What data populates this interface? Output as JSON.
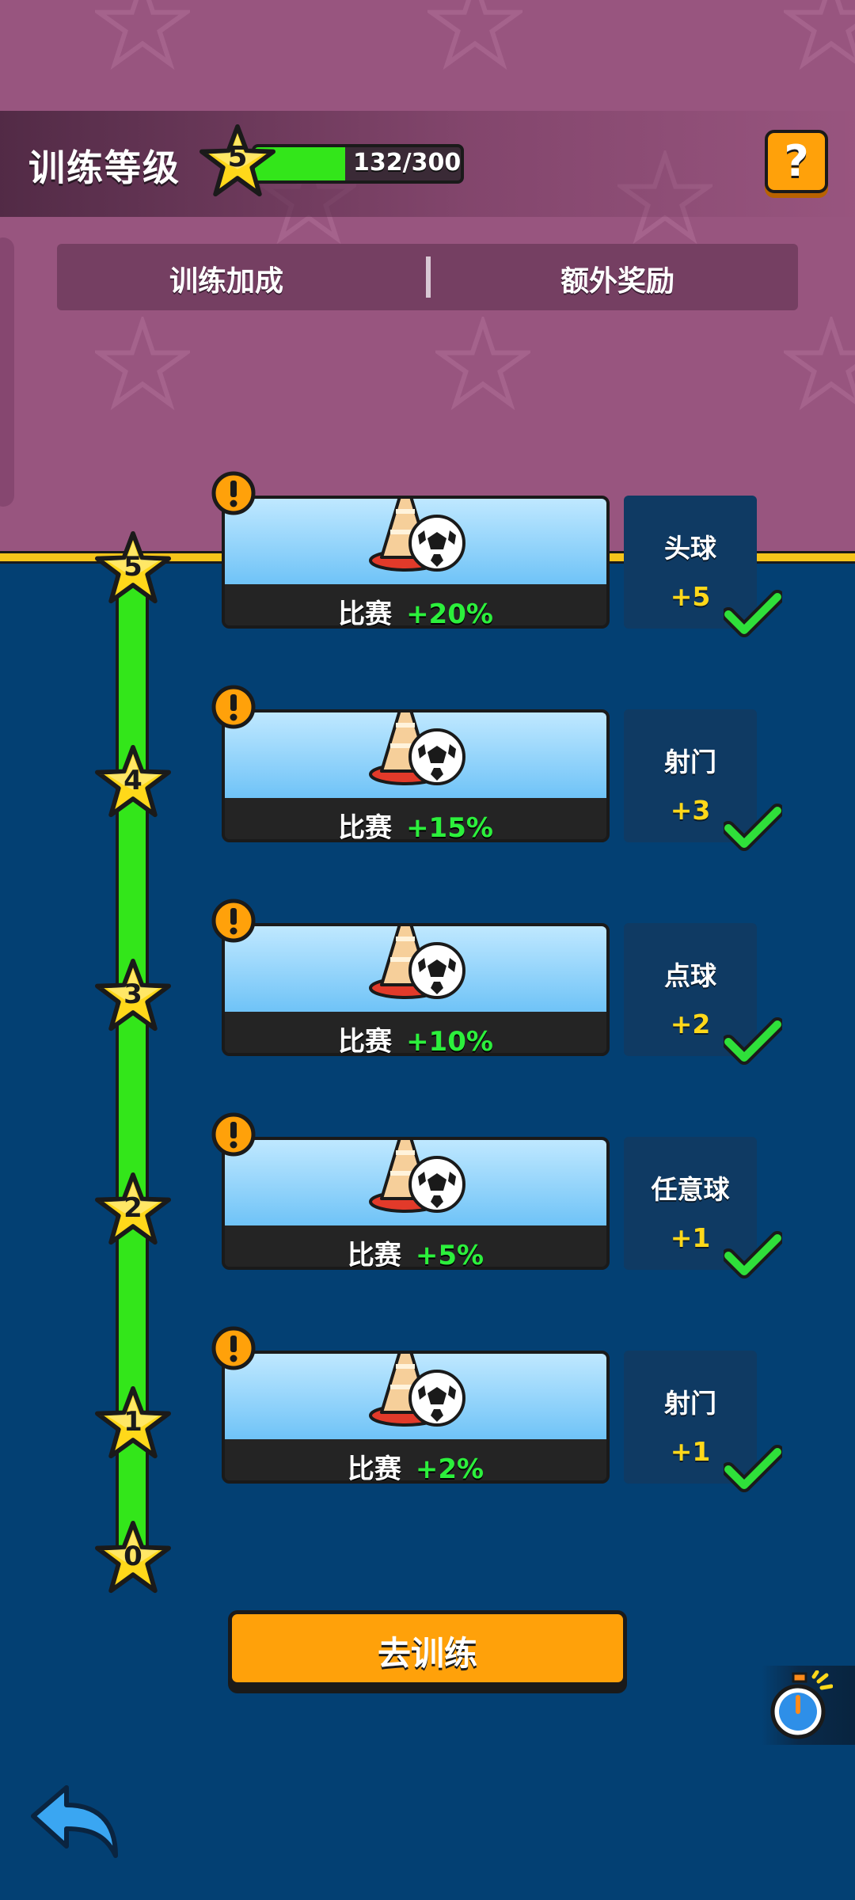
{
  "header": {
    "title": "训练等级",
    "level": "5",
    "xp_text": "132/300",
    "xp_progress": 0.44,
    "help_label": "?"
  },
  "tabs": [
    {
      "label": "训练加成"
    },
    {
      "label": "额外奖励"
    }
  ],
  "track": {
    "star_levels": [
      "5",
      "4",
      "3",
      "2",
      "1",
      "0"
    ]
  },
  "levels": [
    {
      "bonus_label": "比赛",
      "bonus_value": "+20%",
      "reward_name": "头球",
      "reward_value": "+5",
      "claimed": true
    },
    {
      "bonus_label": "比赛",
      "bonus_value": "+15%",
      "reward_name": "射门",
      "reward_value": "+3",
      "claimed": true
    },
    {
      "bonus_label": "比赛",
      "bonus_value": "+10%",
      "reward_name": "点球",
      "reward_value": "+2",
      "claimed": true
    },
    {
      "bonus_label": "比赛",
      "bonus_value": "+5%",
      "reward_name": "任意球",
      "reward_value": "+1",
      "claimed": true
    },
    {
      "bonus_label": "比赛",
      "bonus_value": "+2%",
      "reward_name": "射门",
      "reward_value": "+1",
      "claimed": true
    }
  ],
  "actions": {
    "train_label": "去训练"
  },
  "colors": {
    "top_bg": "#98557f",
    "bottom_bg": "#034073",
    "progress_green": "#33e61a",
    "button_orange": "#ffa10a",
    "reward_value_yellow": "#ffd81a",
    "bonus_value_green": "#2cf03c"
  }
}
